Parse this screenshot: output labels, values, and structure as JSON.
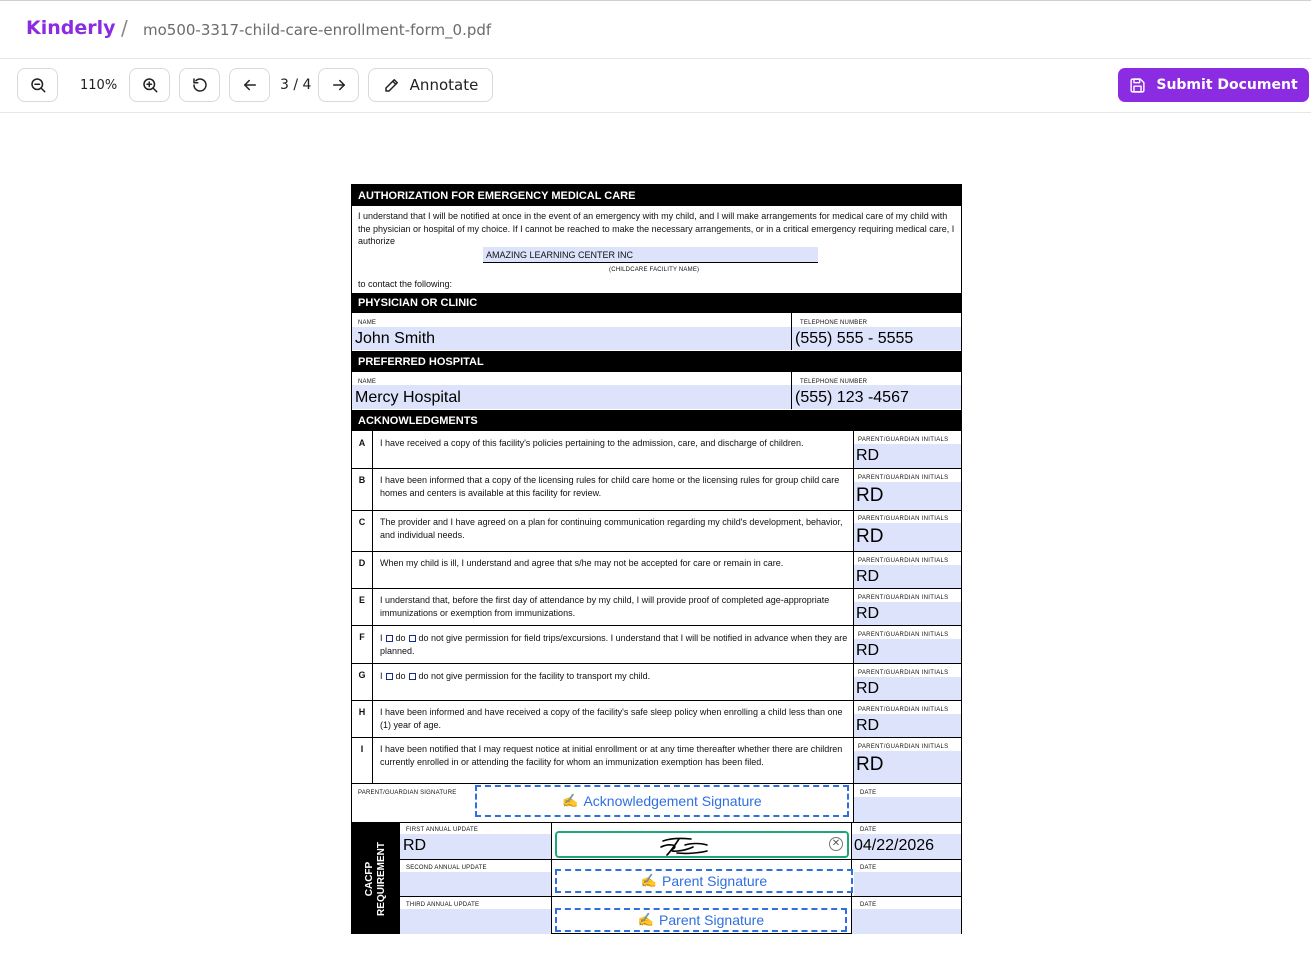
{
  "header": {
    "brand": "Kinderly",
    "separator": "/",
    "filename": "mo500-3317-child-care-enrollment-form_0.pdf"
  },
  "toolbar": {
    "zoom_level": "110%",
    "page_indicator": "3 / 4",
    "annotate_label": "Annotate",
    "submit_label": "Submit Document",
    "accent_color": "#8b2be2"
  },
  "form": {
    "emergency_header": "AUTHORIZATION FOR EMERGENCY MEDICAL CARE",
    "emergency_text": "I understand that I will be notified at once in the event of an emergency with my child, and I will make arrangements for medical care of my child with the physician or hospital of my choice. If I cannot be reached to make the necessary arrangements, or in a critical emergency requiring medical care, I authorize",
    "facility_value": "AMAZING LEARNING CENTER INC",
    "facility_caption": "(CHILDCARE FACILITY NAME)",
    "contact_text": "to contact the following:",
    "physician_header": "PHYSICIAN OR CLINIC",
    "name_label": "NAME",
    "phone_label": "TELEPHONE NUMBER",
    "physician_name": "John Smith",
    "physician_phone": "(555) 555 - 5555",
    "hospital_header": "PREFERRED HOSPITAL",
    "hospital_name": "Mercy Hospital",
    "hospital_phone": "(555) 123 -4567",
    "ack_header": "ACKNOWLEDGMENTS",
    "initials_label": "PARENT/GUARDIAN INITIALS",
    "do_label": "do",
    "do_not_f": "do not give permission for field trips/excursions. I understand that I will be notified in advance when they are planned.",
    "do_not_g": "do not give permission for the facility to transport my child.",
    "i_label": "I",
    "acks": [
      {
        "letter": "A",
        "text": "I have received a copy of this facility's policies pertaining to the admission, care, and discharge of children.",
        "initials": "RD"
      },
      {
        "letter": "B",
        "text": "I have been informed that a copy of the licensing rules for child care home or the licensing rules for group child care homes and centers is available at this facility for review.",
        "initials": "RD"
      },
      {
        "letter": "C",
        "text": "The provider and I have agreed on a plan for continuing communication regarding my child's development, behavior, and individual needs.",
        "initials": "RD"
      },
      {
        "letter": "D",
        "text": "When my child is ill, I understand and agree that s/he may not be accepted for care or remain in care.",
        "initials": "RD"
      },
      {
        "letter": "E",
        "text": "I understand that, before the first day of attendance by my child, I will provide proof of completed age-appropriate immunizations or exemption from immunizations.",
        "initials": "RD"
      },
      {
        "letter": "F",
        "text": "",
        "initials": "RD"
      },
      {
        "letter": "G",
        "text": "",
        "initials": "RD"
      },
      {
        "letter": "H",
        "text": "I have been informed and have received a copy of the facility's safe sleep policy when enrolling a child less than one (1) year of age.",
        "initials": "RD"
      },
      {
        "letter": "I",
        "text": "I have been notified that I may request notice at initial enrollment or at any time thereafter whether there are children currently enrolled in or attending the facility for whom an immunization exemption has been filed.",
        "initials": "RD"
      }
    ],
    "sig_label": "PARENT/GUARDIAN SIGNATURE",
    "date_label": "DATE",
    "ack_signature_placeholder": "Acknowledgement Signature",
    "cacfp_label": "CACFP REQUIREMENT",
    "first_update_label": "FIRST ANNUAL UPDATE",
    "second_update_label": "SECOND ANNUAL UPDATE",
    "third_update_label": "THIRD ANNUAL UPDATE",
    "first_update_value": "RD",
    "first_date_value": "04/22/2026",
    "parent_signature_placeholder": "Parent Signature",
    "pen_glyph": "✍"
  }
}
